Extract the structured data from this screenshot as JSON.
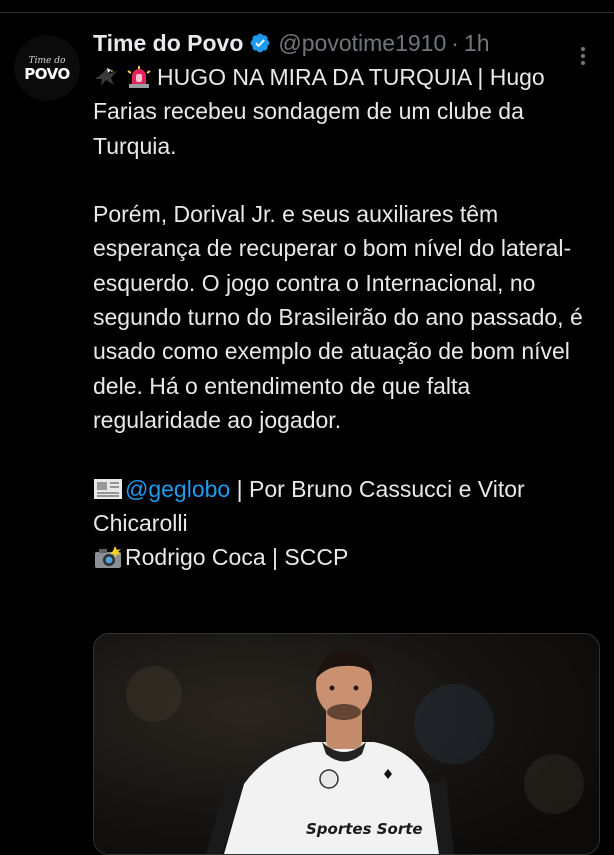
{
  "tweet": {
    "author_name": "Time do Povo",
    "handle": "@povotime1910",
    "separator": "·",
    "timestamp": "1h",
    "avatar": {
      "script_text": "Time do",
      "main_text": "POVO"
    },
    "line1_text": "HUGO NA MIRA DA TURQUIA | Hugo Farias recebeu sondagem de um clube da Turquia.",
    "paragraph2": "Porém, Dorival Jr. e seus auxiliares têm esperança de recuperar o bom nível do lateral-esquerdo. O jogo contra o Internacional, no segundo turno do Brasileirão do ano passado, é usado como exemplo de atuação de bom nível dele. Há o entendimento de que falta regularidade ao jogador.",
    "credit_mention": "@geglobo",
    "credit_text": " | Por Bruno Cassucci e Vitor Chicarolli",
    "photo_credit": "Rodrigo Coca | SCCP",
    "jersey_text": "Sportes Sorte",
    "icons": {
      "verified": "verified-badge-icon",
      "more": "more-options-icon",
      "line1_emoji_a": "eagle-emoji-icon",
      "line1_emoji_b": "siren-emoji-icon",
      "credit_emoji": "newspaper-emoji-icon",
      "photo_emoji": "camera-flash-emoji-icon"
    }
  },
  "colors": {
    "background": "#000000",
    "text": "#e7e9ea",
    "muted": "#71767b",
    "link": "#1d9bf0",
    "verified": "#1d9bf0"
  }
}
